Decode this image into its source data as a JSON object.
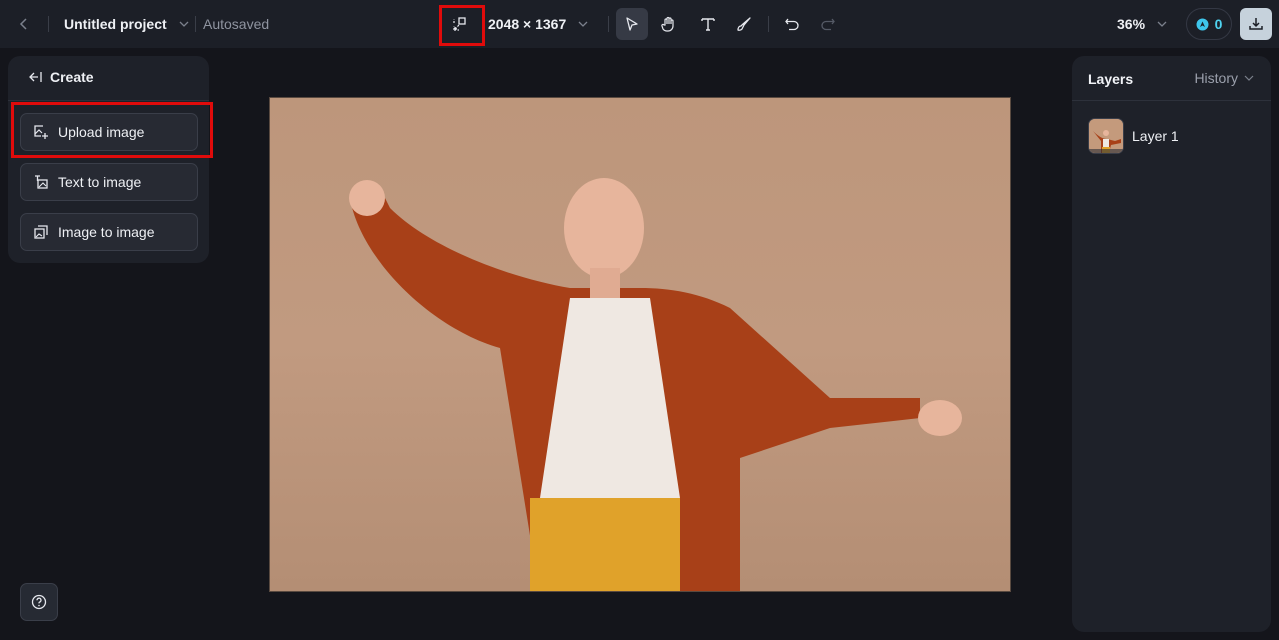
{
  "topbar": {
    "back_icon": "chevron-left-icon",
    "project_title": "Untitled project",
    "save_status": "Autosaved",
    "resize_icon": "resize-canvas-icon",
    "canvas_size": "2048 × 1367",
    "tools": [
      {
        "name": "select",
        "icon": "cursor-arrow-icon",
        "active": true
      },
      {
        "name": "hand",
        "icon": "hand-icon",
        "active": false
      },
      {
        "name": "text",
        "icon": "text-icon",
        "active": false
      },
      {
        "name": "brush",
        "icon": "brush-icon",
        "active": false
      }
    ],
    "undo_icon": "undo-icon",
    "redo_icon": "redo-icon",
    "zoom_level": "36%",
    "credits": "0",
    "download_icon": "download-icon"
  },
  "left_panel": {
    "header": "Create",
    "items": [
      {
        "label": "Upload image",
        "icon": "upload-image-icon",
        "highlighted": true
      },
      {
        "label": "Text to image",
        "icon": "text-to-image-icon"
      },
      {
        "label": "Image to image",
        "icon": "image-to-image-icon"
      }
    ]
  },
  "right_panel": {
    "title": "Layers",
    "history_label": "History",
    "layers": [
      {
        "name": "Layer 1"
      }
    ]
  },
  "canvas": {
    "image_description": "Woman with shaved head in orange knit cardigan, white blouse and yellow pants, arms outstretched, smiling, beige background"
  },
  "annotations": {
    "highlight_color": "#e00b0b"
  },
  "colors": {
    "topbar_bg": "#1c1f27",
    "workspace_bg": "#14151b",
    "panel_bg": "#1e2129",
    "accent_credit": "#4fd3f0"
  }
}
